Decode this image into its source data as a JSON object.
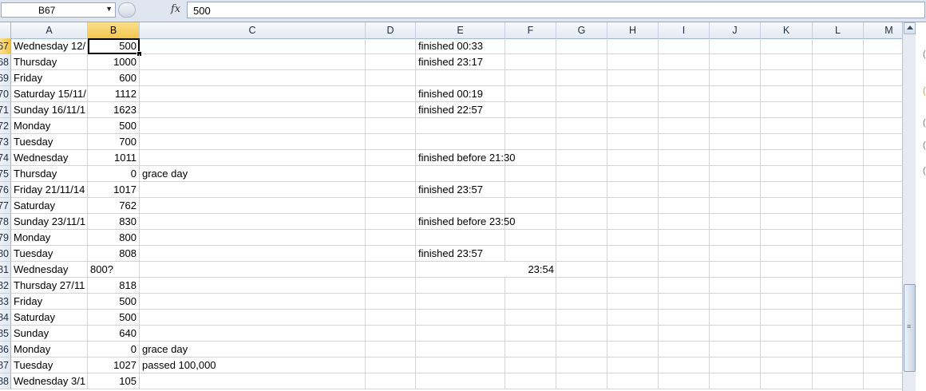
{
  "formula_bar": {
    "name_box": "B67",
    "fx_label": "fx",
    "formula": "500"
  },
  "columns": [
    "A",
    "B",
    "C",
    "D",
    "E",
    "F",
    "G",
    "H",
    "I",
    "J",
    "K",
    "L",
    "M"
  ],
  "selected_column": "B",
  "rows": [
    {
      "num": "67",
      "a": "Wednesday 12/",
      "b": "500",
      "c": "",
      "e": "finished 00:33"
    },
    {
      "num": "68",
      "a": "Thursday",
      "b": "1000",
      "c": "",
      "e": "finished 23:17"
    },
    {
      "num": "69",
      "a": "Friday",
      "b": "600",
      "c": "",
      "e": ""
    },
    {
      "num": "70",
      "a": "Saturday 15/11/",
      "b": "1112",
      "c": "",
      "e": "finished 00:19"
    },
    {
      "num": "71",
      "a": "Sunday 16/11/1",
      "b": "1623",
      "c": "",
      "e": "finished 22:57"
    },
    {
      "num": "72",
      "a": "Monday",
      "b": "500",
      "c": "",
      "e": ""
    },
    {
      "num": "73",
      "a": "Tuesday",
      "b": "700",
      "c": "",
      "e": ""
    },
    {
      "num": "74",
      "a": "Wednesday",
      "b": "1011",
      "c": "",
      "e": "finished before 21:30"
    },
    {
      "num": "75",
      "a": "Thursday",
      "b": "0",
      "c": "grace day",
      "e": ""
    },
    {
      "num": "76",
      "a": "Friday 21/11/14",
      "b": "1017",
      "c": "",
      "e": "finished 23:57"
    },
    {
      "num": "77",
      "a": "Saturday",
      "b": "762",
      "c": "",
      "e": ""
    },
    {
      "num": "78",
      "a": "Sunday 23/11/1",
      "b": "830",
      "c": "",
      "e": "finished before 23:50"
    },
    {
      "num": "79",
      "a": "Monday",
      "b": "800",
      "c": "",
      "e": ""
    },
    {
      "num": "80",
      "a": "Tuesday",
      "b": "808",
      "c": "",
      "e": "finished 23:57"
    },
    {
      "num": "81",
      "a": "Wednesday",
      "b": "800?",
      "b_text": true,
      "c": "",
      "e": "23:54",
      "e_right": true
    },
    {
      "num": "82",
      "a": "Thursday 27/11",
      "b": "818",
      "c": "",
      "e": ""
    },
    {
      "num": "83",
      "a": "Friday",
      "b": "500",
      "c": "",
      "e": ""
    },
    {
      "num": "84",
      "a": "Saturday",
      "b": "500",
      "c": "",
      "e": ""
    },
    {
      "num": "85",
      "a": "Sunday",
      "b": "640",
      "c": "",
      "e": ""
    },
    {
      "num": "86",
      "a": "Monday",
      "b": "0",
      "c": "grace day",
      "e": ""
    },
    {
      "num": "87",
      "a": "Tuesday",
      "b": "1027",
      "c": "passed 100,000",
      "e": ""
    },
    {
      "num": "88",
      "a": "Wednesday 3/1",
      "b": "105",
      "c": "",
      "e": ""
    }
  ]
}
